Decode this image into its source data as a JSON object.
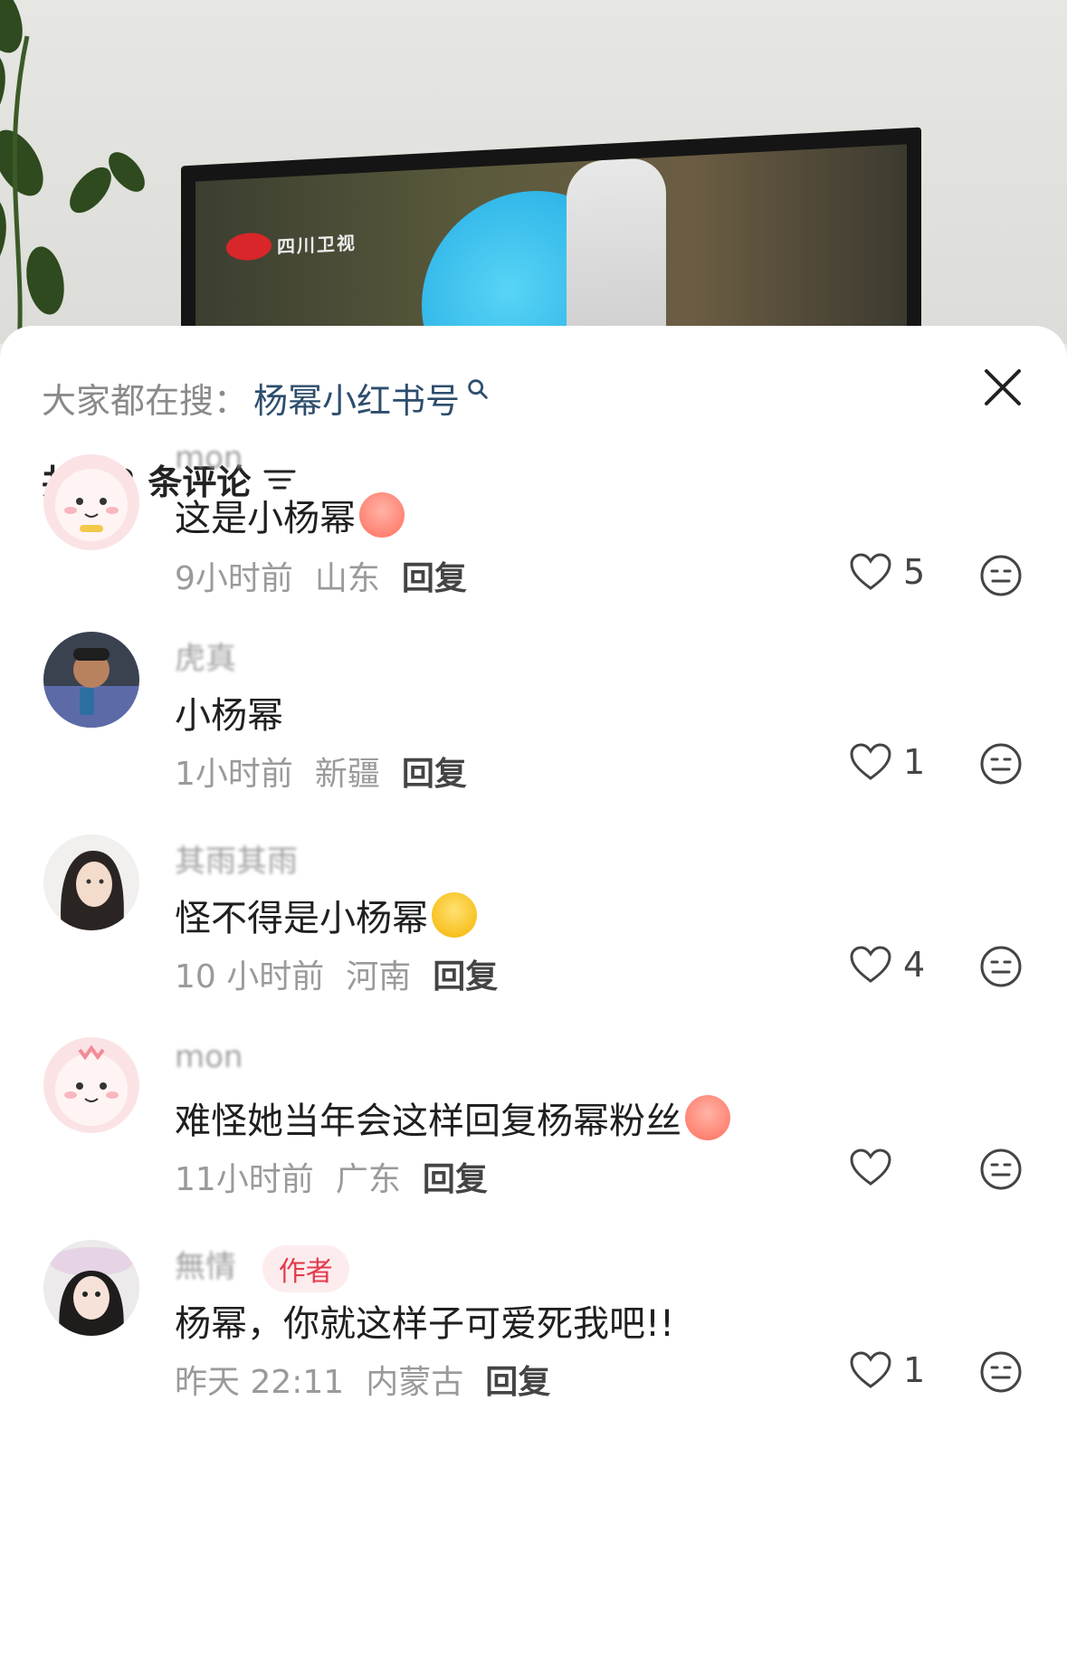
{
  "video": {
    "channel_logo_text": "四川卫视",
    "colors": {
      "logo_red": "#d8262a",
      "blue_object": "#33b8ea"
    }
  },
  "search": {
    "label": "大家都在搜：",
    "term": "杨幂小红书号",
    "icon": "search-icon"
  },
  "header": {
    "count_text": "共 12 条评论",
    "sort_icon": "sort-icon",
    "close_icon": "close-icon"
  },
  "comments": [
    {
      "username": "mon",
      "text": "这是小杨幂",
      "time": "9小时前",
      "location": "山东",
      "reply_label": "回复",
      "likes": "5",
      "emoji": "crying-face"
    },
    {
      "username": "虎真",
      "text": "小杨幂",
      "time": "1小时前",
      "location": "新疆",
      "reply_label": "回复",
      "likes": "1"
    },
    {
      "username": "其雨其雨",
      "text": "怪不得是小杨幂",
      "time": "10 小时前",
      "location": "河南",
      "reply_label": "回复",
      "likes": "4",
      "emoji": "laughing-face"
    },
    {
      "username": "mon",
      "text": "难怪她当年会这样回复杨幂粉丝",
      "time": "11小时前",
      "location": "广东",
      "reply_label": "回复",
      "likes": "",
      "emoji": "crying-face"
    },
    {
      "username": "無情",
      "badge": "作者",
      "text": "杨幂，你就这样子可爱死我吧!!",
      "time": "昨天 22:11",
      "location": "内蒙古",
      "reply_label": "回复",
      "likes": "1"
    }
  ],
  "colors": {
    "link_blue": "#2d4d6d",
    "badge_bg": "#fdecee",
    "badge_text": "#e33b4c"
  }
}
